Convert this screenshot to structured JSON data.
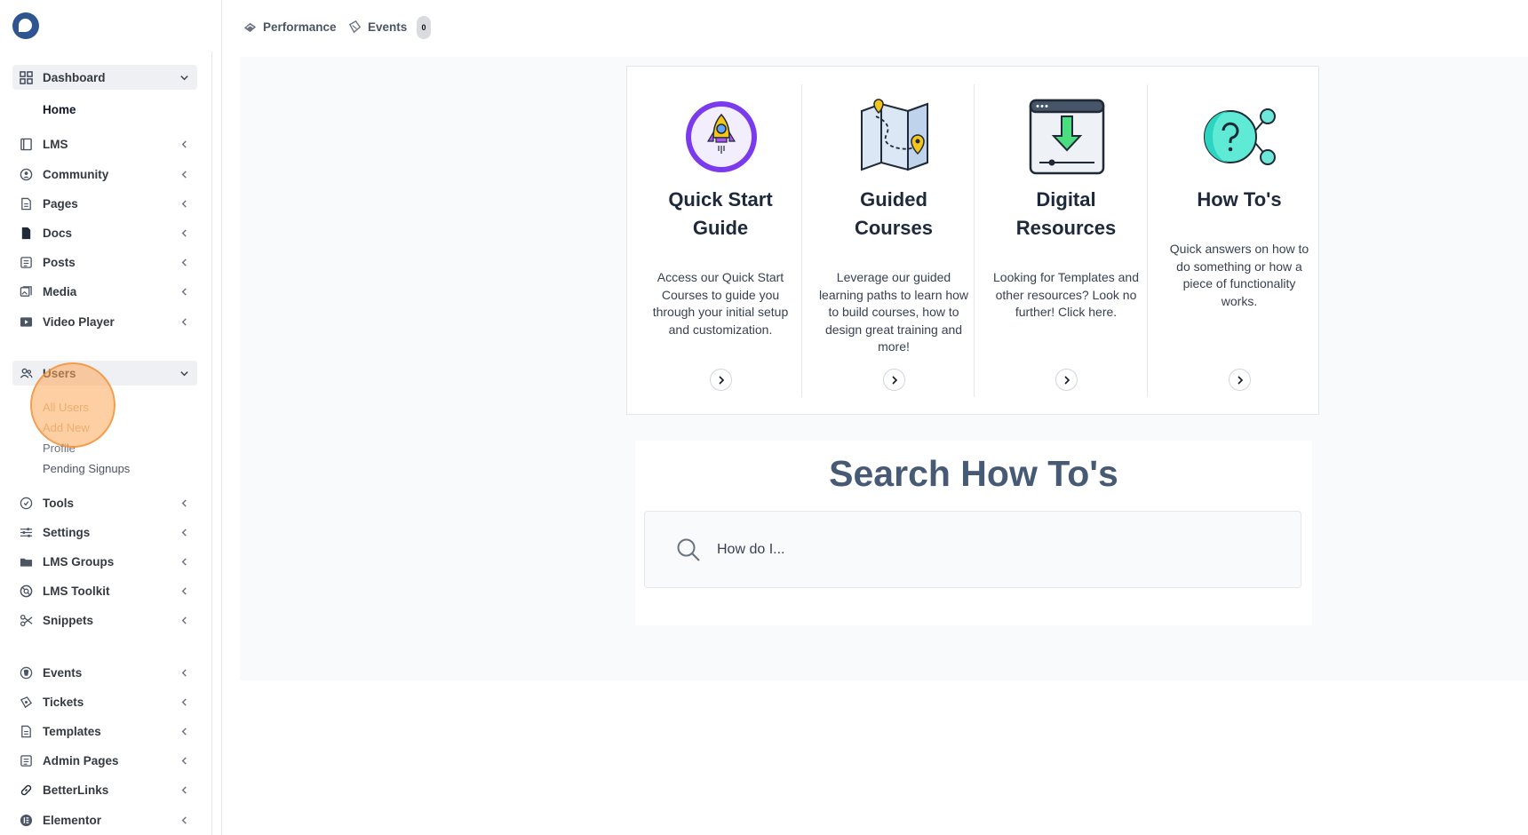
{
  "topbar": {
    "performance_label": "Performance",
    "events_label": "Events",
    "events_badge": "0"
  },
  "sidebar": {
    "dashboard": {
      "label": "Dashboard",
      "sub": {
        "home": "Home"
      }
    },
    "lms": "LMS",
    "community": "Community",
    "pages": "Pages",
    "docs": "Docs",
    "posts": "Posts",
    "media": "Media",
    "video_player": "Video Player",
    "users": {
      "label": "Users",
      "sub": {
        "all_users": "All Users",
        "add_new": "Add New",
        "profile": "Profile",
        "pending_signups": "Pending Signups"
      }
    },
    "tools": "Tools",
    "settings": "Settings",
    "lms_groups": "LMS Groups",
    "lms_toolkit": "LMS Toolkit",
    "snippets": "Snippets",
    "events": "Events",
    "tickets": "Tickets",
    "templates": "Templates",
    "admin_pages": "Admin Pages",
    "betterlinks": "BetterLinks",
    "elementor": "Elementor"
  },
  "cards": [
    {
      "title_line1": "Quick Start",
      "title_line2": "Guide",
      "desc": "Access our Quick Start Courses to guide you through your initial setup and customization.",
      "icon": "rocket-icon"
    },
    {
      "title_line1": "Guided",
      "title_line2": "Courses",
      "desc": "Leverage our guided learning paths to learn how to build courses, how to design great training and more!",
      "icon": "map-icon"
    },
    {
      "title_line1": "Digital",
      "title_line2": "Resources",
      "desc": "Looking for Templates and other resources? Look no further! Click here.",
      "icon": "download-icon"
    },
    {
      "title_line1": "How To's",
      "title_line2": "",
      "desc": "Quick answers on how to do something or how a piece of functionality works.",
      "icon": "question-share-icon"
    }
  ],
  "search": {
    "title": "Search How To's",
    "placeholder": "How do I..."
  },
  "colors": {
    "accent_blue": "#2f5590",
    "title_slate": "#475a75",
    "highlight_orange": "#ffa85a"
  }
}
